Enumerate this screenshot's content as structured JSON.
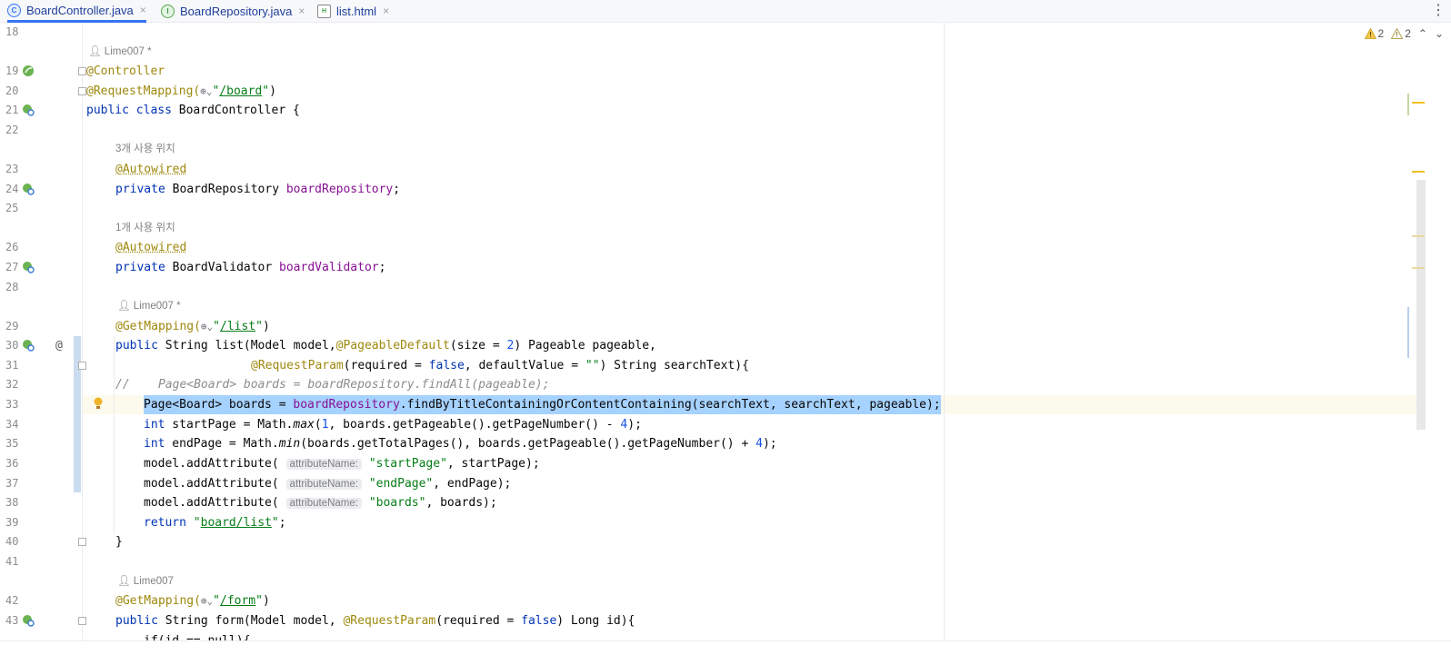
{
  "tabs": [
    {
      "label": "BoardController.java",
      "icon": "class-icon",
      "active": true
    },
    {
      "label": "BoardRepository.java",
      "icon": "interface-icon",
      "active": false
    },
    {
      "label": "list.html",
      "icon": "html-icon",
      "active": false
    }
  ],
  "tab_close": "×",
  "tab_more": "⋮",
  "inspections": {
    "warnings_a": "2",
    "warnings_b": "2"
  },
  "hints": {
    "author_1": "Lime007 *",
    "usages_3": "3개 사용 위치",
    "usages_1": "1개 사용 위치",
    "author_2": "Lime007 *",
    "author_3": "Lime007",
    "attribute_name": "attributeName:"
  },
  "line_numbers": [
    "18",
    "19",
    "20",
    "21",
    "22",
    "23",
    "24",
    "25",
    "26",
    "27",
    "28",
    "29",
    "30",
    "31",
    "32",
    "33",
    "34",
    "35",
    "36",
    "37",
    "38",
    "39",
    "40",
    "41",
    "42",
    "43"
  ],
  "code": {
    "controller_ann": "@Controller",
    "request_mapping": "@RequestMapping(",
    "board_url": "/board",
    "kw_public": "public",
    "kw_class": "class",
    "class_name": "BoardController {",
    "autowired": "@Autowired",
    "kw_private": "private",
    "repo_type": "BoardRepository",
    "repo_field": "boardRepository",
    "validator_type": "BoardValidator",
    "validator_field": "boardValidator",
    "get_mapping": "@GetMapping(",
    "list_url": "/list",
    "list_sig": "String list(Model model,",
    "pageable_default": "@PageableDefault",
    "pageable_rest": "(size = ",
    "two": "2",
    "pageable_tail": ") Pageable pageable,",
    "request_param": "@RequestParam",
    "req_param_args": "(required = ",
    "kw_false": "false",
    "default_value": ", defaultValue = ",
    "empty_str": "\"\"",
    "req_param_tail": ") String searchText){",
    "comment": "//    Page<Board> boards = boardRepository.findAll(pageable);",
    "sel_page": "Page<Board> boards = ",
    "sel_method": ".findByTitleContainingOrContentContaining(searchText, searchText, pageable);",
    "kw_int": "int",
    "start_page_a": " startPage = Math.",
    "max": "max",
    "start_page_b": "(",
    "one": "1",
    "start_page_c": ", boards.getPageable().getPageNumber() - ",
    "four": "4",
    "end_page_a": " endPage = Math.",
    "min": "min",
    "end_page_b": "(boards.getTotalPages(), boards.getPageable().getPageNumber() + ",
    "add_attr": "model.addAttribute(",
    "start_page_str": "\"startPage\"",
    "start_page_tail": ", startPage);",
    "end_page_str": "\"endPage\"",
    "end_page_tail": ", endPage);",
    "boards_str": "\"boards\"",
    "boards_tail": ", boards);",
    "kw_return": "return",
    "board_list_url": "board/list",
    "close_brace": "}",
    "form_url": "/form",
    "form_sig": "String form(Model model, ",
    "form_tail": ") Long id){",
    "if_line": "if(id == null){",
    "paren_close": ")",
    "semi": ";",
    "quote": "\"",
    "at_sign": "@"
  },
  "colors": {
    "keyword": "#0033b3",
    "annotation": "#9e880d",
    "field": "#871094",
    "string": "#067d17",
    "number": "#1750eb",
    "selection": "#a6d2ff"
  }
}
